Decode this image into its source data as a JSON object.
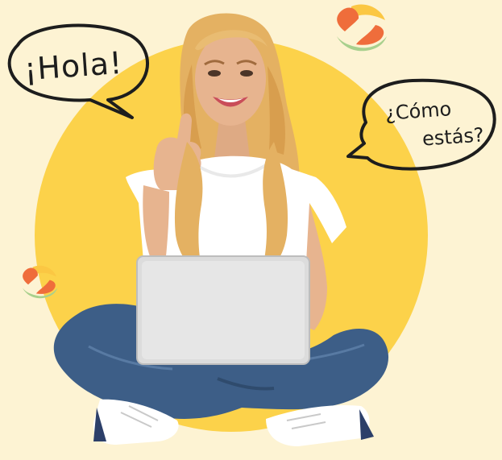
{
  "colors": {
    "background": "#fdf3d3",
    "circle": "#fcd24a",
    "bubble_stroke": "#1d1d1d",
    "logo_orange": "#ef6d3b",
    "logo_yellow": "#fbc743",
    "logo_green": "#a8d08d",
    "shirt": "#ffffff",
    "jeans": "#3d5e87",
    "laptop": "#dcdcdc",
    "hair": "#e4b162",
    "skin": "#e7b48f"
  },
  "speech": {
    "hola": "¡Hola!",
    "como_line1": "¿Cómo",
    "como_line2": "estás?"
  },
  "icons": {
    "logo_top": "logo-icon",
    "logo_left": "logo-icon"
  }
}
